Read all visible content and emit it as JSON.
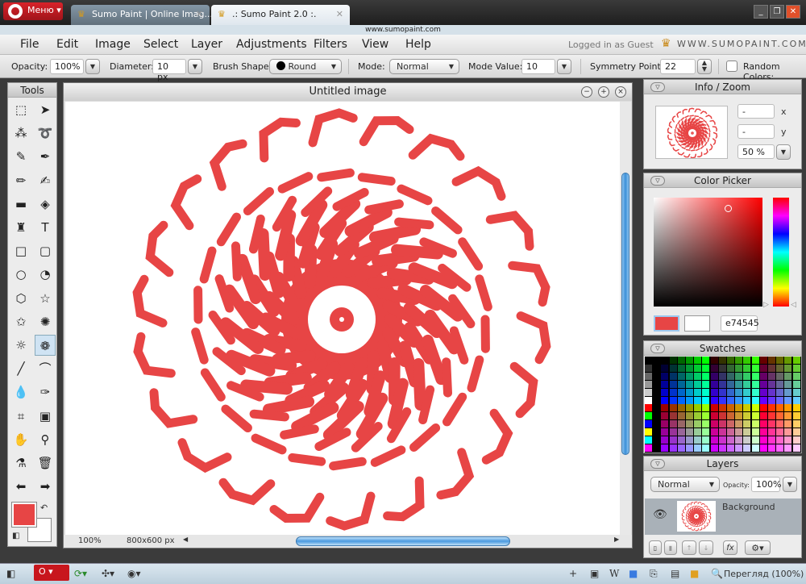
{
  "browser": {
    "menu_label": "Меню",
    "tabs": [
      {
        "title": "Sumo Paint | Online Imag..."
      },
      {
        "title": ".: Sumo Paint 2.0 :."
      }
    ],
    "url": "www.sumopaint.com",
    "zoom_status": "Перегляд (100%)"
  },
  "menu": {
    "items": [
      "File",
      "Edit",
      "Image",
      "Select",
      "Layer",
      "Adjustments",
      "Filters",
      "View",
      "Help"
    ],
    "logged_in": "Logged in as Guest",
    "brand": "WWW.SUMOPAINT.COM"
  },
  "toolbar": {
    "opacity_label": "Opacity:",
    "opacity": "100%",
    "diameter_label": "Diameter:",
    "diameter": "10 px",
    "brush_shape_label": "Brush Shape:",
    "brush_shape": "Round",
    "mode_label": "Mode:",
    "mode": "Normal",
    "mode_value_label": "Mode Value:",
    "mode_value": "10",
    "symmetry_label": "Symmetry Points:",
    "symmetry_points": "22",
    "random_colors_label": "Random Colors:",
    "random_colors": false
  },
  "tools": {
    "title": "Tools",
    "items": [
      "rect-select",
      "move",
      "magic-wand",
      "lasso",
      "brush",
      "ink-brush",
      "pencil",
      "smudge",
      "gradient",
      "fill",
      "stamp",
      "text",
      "rectangle",
      "rounded-rect",
      "ellipse",
      "blob",
      "hexagon",
      "star",
      "star-outline",
      "burst",
      "custom-shape",
      "symmetry-flower",
      "line",
      "curve",
      "drop",
      "pen",
      "crop",
      "transform",
      "hand",
      "zoom",
      "eyedropper",
      "trash",
      "undo",
      "redo"
    ],
    "active": "symmetry-flower"
  },
  "colors": {
    "primary": "#e74545",
    "secondary": "#ffffff"
  },
  "image_window": {
    "title": "Untitled image",
    "zoom": "100%",
    "size": "800x600 px",
    "symmetry_points": 22,
    "stroke_color": "#e74545"
  },
  "info_zoom": {
    "title": "Info / Zoom",
    "x": "-",
    "x_label": "x",
    "y": "-",
    "y_label": "y",
    "zoom": "50 %"
  },
  "color_picker": {
    "title": "Color Picker",
    "hex": "e74545"
  },
  "swatches": {
    "title": "Swatches"
  },
  "layers": {
    "title": "Layers",
    "blend_mode": "Normal",
    "opacity_label": "Opacity:",
    "opacity": "100%",
    "items": [
      {
        "name": "Background",
        "visible": true
      }
    ]
  }
}
